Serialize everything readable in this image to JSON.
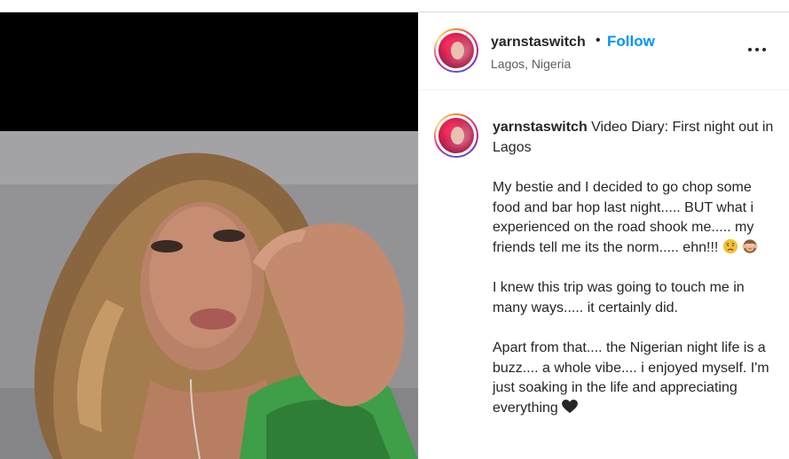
{
  "post": {
    "username": "yarnstaswitch",
    "separator": "•",
    "follow_label": "Follow",
    "location": "Lagos, Nigeria",
    "more_icon": "more-options-icon"
  },
  "caption": {
    "username": "yarnstaswitch",
    "title": "Video Diary: First night out in Lagos",
    "paragraphs": [
      "My bestie and I decided to go chop some food and bar hop last night..... BUT what i experienced on the road shook me..... my friends tell me its the norm..... ehn!!! ",
      "I knew this trip was going to touch me in many ways..... it certainly did.",
      "Apart from that.... the Nigerian night life is a buzz.... a whole vibe.... i enjoyed myself. I'm just soaking in the life and appreciating everything "
    ],
    "emojis": [
      "disappointed-face-icon",
      "see-no-evil-monkey-icon",
      "black-heart-icon"
    ]
  },
  "colors": {
    "follow": "#0095f6",
    "text": "#262626",
    "secondary": "#5e5e5e"
  }
}
